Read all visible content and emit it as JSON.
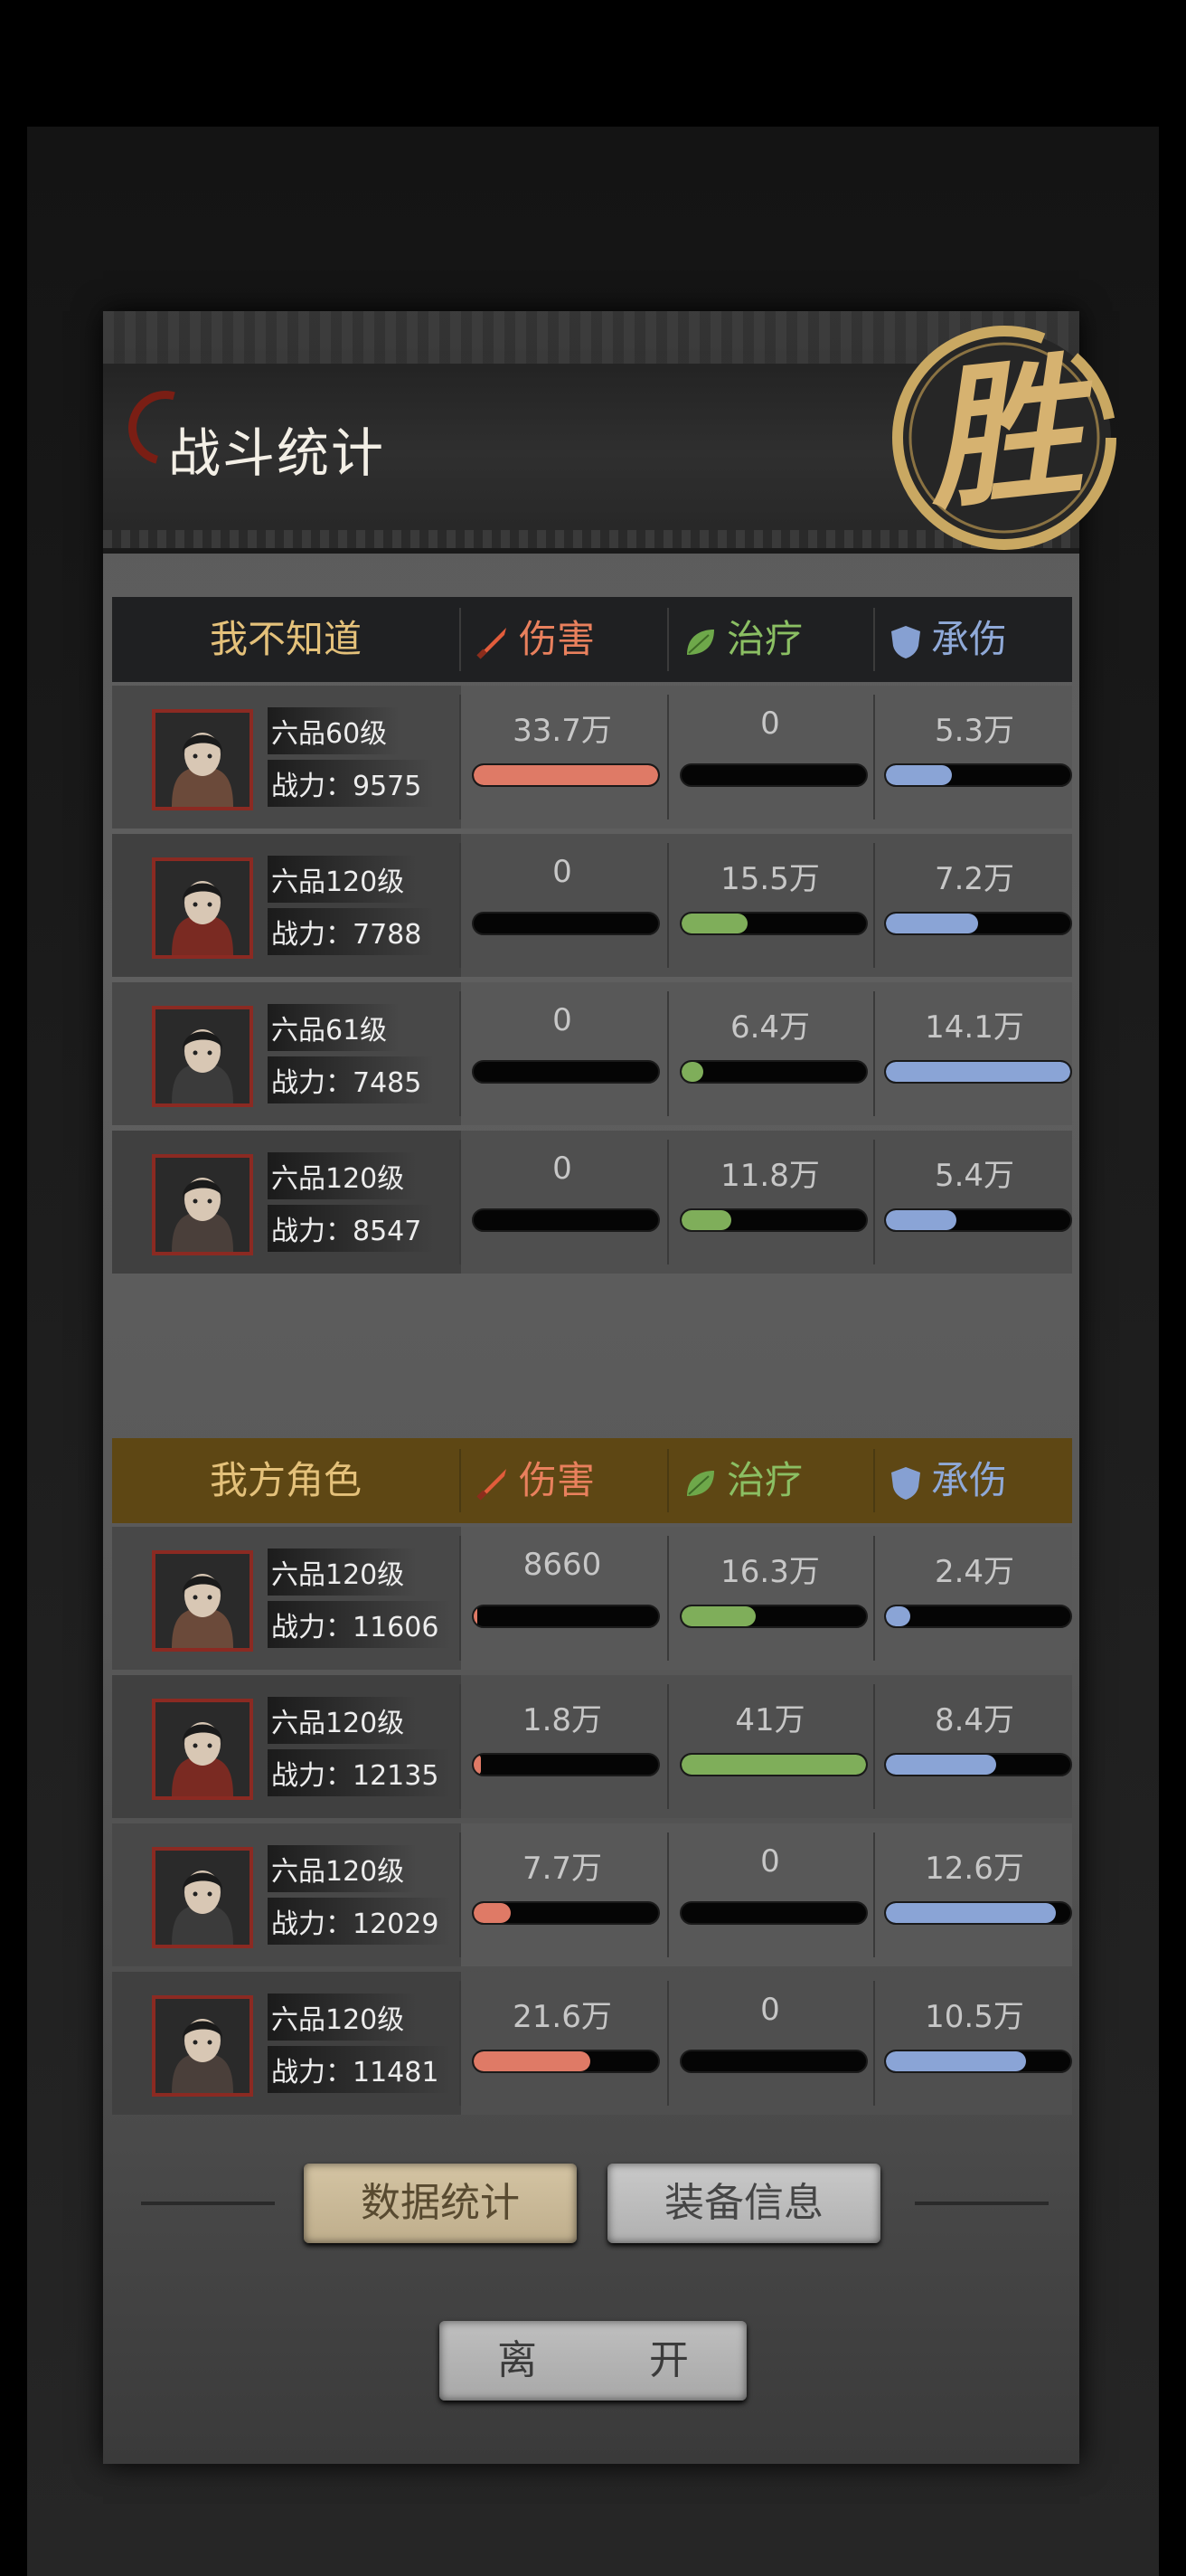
{
  "title": "战斗统计",
  "result_badge": "胜",
  "columns": {
    "damage": "伤害",
    "heal": "治疗",
    "tank": "承伤"
  },
  "enemy": {
    "name": "我不知道",
    "rows": [
      {
        "level": "六品60级",
        "power": "战力：9575",
        "damage": "33.7万",
        "heal": "0",
        "tank": "5.3万",
        "damage_pct": 1.0,
        "heal_pct": 0,
        "tank_pct": 0.36
      },
      {
        "level": "六品120级",
        "power": "战力：7788",
        "damage": "0",
        "heal": "15.5万",
        "tank": "7.2万",
        "damage_pct": 0,
        "heal_pct": 0.36,
        "tank_pct": 0.5
      },
      {
        "level": "六品61级",
        "power": "战力：7485",
        "damage": "0",
        "heal": "6.4万",
        "tank": "14.1万",
        "damage_pct": 0,
        "heal_pct": 0.12,
        "tank_pct": 1.0
      },
      {
        "level": "六品120级",
        "power": "战力：8547",
        "damage": "0",
        "heal": "11.8万",
        "tank": "5.4万",
        "damage_pct": 0,
        "heal_pct": 0.27,
        "tank_pct": 0.38
      }
    ]
  },
  "ally": {
    "name": "我方角色",
    "rows": [
      {
        "level": "六品120级",
        "power": "战力：11606",
        "damage": "8660",
        "heal": "16.3万",
        "tank": "2.4万",
        "damage_pct": 0.02,
        "heal_pct": 0.4,
        "tank_pct": 0.13
      },
      {
        "level": "六品120级",
        "power": "战力：12135",
        "damage": "1.8万",
        "heal": "41万",
        "tank": "8.4万",
        "damage_pct": 0.04,
        "heal_pct": 1.0,
        "tank_pct": 0.6
      },
      {
        "level": "六品120级",
        "power": "战力：12029",
        "damage": "7.7万",
        "heal": "0",
        "tank": "12.6万",
        "damage_pct": 0.2,
        "heal_pct": 0,
        "tank_pct": 0.92
      },
      {
        "level": "六品120级",
        "power": "战力：11481",
        "damage": "21.6万",
        "heal": "0",
        "tank": "10.5万",
        "damage_pct": 0.63,
        "heal_pct": 0,
        "tank_pct": 0.76
      }
    ]
  },
  "buttons": {
    "stats": "数据统计",
    "equip": "装备信息",
    "leave": "离　开"
  },
  "colors": {
    "damage": "#df7a66",
    "heal": "#7fae5a",
    "tank": "#8aa4d6",
    "avatar_border": "#8b2a22",
    "seal": "#d6b270"
  }
}
